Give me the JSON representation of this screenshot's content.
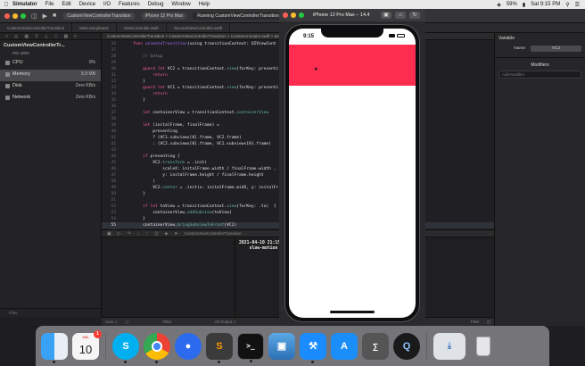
{
  "menubar": {
    "apple_icon": "apple-logo",
    "app_name": "Simulator",
    "items": [
      "File",
      "Edit",
      "Device",
      "I/O",
      "Features",
      "Debug",
      "Window",
      "Help"
    ],
    "battery": "59%",
    "clock": "Sat 9:15 PM"
  },
  "xcode": {
    "scheme": "CustomViewControllerTransition",
    "device": "iPhone 12 Pro Max",
    "status": "Running CustomViewControllerTransition on iPhone 12 Pro Max",
    "tabs": [
      "CustomViewControllerTransition",
      "Main.storyboard",
      "ViewController.swift",
      "SecondViewController.swift"
    ],
    "jumpbar": "CustomViewControllerTransition > CustomViewControllerTransition > CustomAnimator.swift > animateTransition(using:)"
  },
  "navigator": {
    "project": "CustomViewControllerTr...",
    "pid": "PID 4800",
    "gauges": [
      {
        "name": "CPU",
        "value": "0%"
      },
      {
        "name": "Memory",
        "value": "8.8 MB"
      },
      {
        "name": "Disk",
        "value": "Zero KB/s"
      },
      {
        "name": "Network",
        "value": "Zero KB/s"
      }
    ],
    "filter": "Filter"
  },
  "code": {
    "lines": [
      {
        "n": "26",
        "parts": [
          {
            "c": "kw",
            "t": "    func "
          },
          {
            "c": "fn",
            "t": "animateTransition"
          },
          {
            "c": "",
            "t": "(using transitionContext: UIViewCont"
          }
        ]
      },
      {
        "n": "27",
        "parts": []
      },
      {
        "n": "28",
        "parts": [
          {
            "c": "cm",
            "t": "        // Setup"
          }
        ]
      },
      {
        "n": "29",
        "parts": []
      },
      {
        "n": "30",
        "parts": [
          {
            "c": "kw",
            "t": "        guard let "
          },
          {
            "c": "",
            "t": "VC2 = transitionContext."
          },
          {
            "c": "pr",
            "t": "view"
          },
          {
            "c": "",
            "t": "(forKey: presenti"
          }
        ]
      },
      {
        "n": "31",
        "parts": [
          {
            "c": "kw",
            "t": "            return"
          }
        ]
      },
      {
        "n": "32",
        "parts": [
          {
            "c": "",
            "t": "        }"
          }
        ]
      },
      {
        "n": "33",
        "parts": [
          {
            "c": "kw",
            "t": "        guard let "
          },
          {
            "c": "",
            "t": "VC1 = transitionContext."
          },
          {
            "c": "pr",
            "t": "view"
          },
          {
            "c": "",
            "t": "(forKey: presenti"
          }
        ]
      },
      {
        "n": "34",
        "parts": [
          {
            "c": "kw",
            "t": "            return"
          }
        ]
      },
      {
        "n": "35",
        "parts": [
          {
            "c": "",
            "t": "        }"
          }
        ]
      },
      {
        "n": "36",
        "parts": []
      },
      {
        "n": "37",
        "parts": [
          {
            "c": "kw",
            "t": "        let "
          },
          {
            "c": "",
            "t": "containerView = transitionContext."
          },
          {
            "c": "pr",
            "t": "containerView"
          }
        ]
      },
      {
        "n": "38",
        "parts": []
      },
      {
        "n": "39",
        "parts": [
          {
            "c": "kw",
            "t": "        let "
          },
          {
            "c": "",
            "t": "(initalFrame, finalFrame) ="
          }
        ]
      },
      {
        "n": "40",
        "parts": [
          {
            "c": "",
            "t": "            presenting"
          }
        ]
      },
      {
        "n": "41",
        "parts": [
          {
            "c": "",
            "t": "            ? (VC1.subviews[0].frame, VC2.frame)"
          }
        ]
      },
      {
        "n": "42",
        "parts": [
          {
            "c": "",
            "t": "            : (VC2.subviews[0].frame, VC1.subviews[0].frame)"
          }
        ]
      },
      {
        "n": "43",
        "parts": []
      },
      {
        "n": "44",
        "parts": [
          {
            "c": "kw",
            "t": "        if "
          },
          {
            "c": "",
            "t": "presenting {"
          }
        ]
      },
      {
        "n": "45",
        "parts": [
          {
            "c": "",
            "t": "            VC2."
          },
          {
            "c": "pr",
            "t": "transform"
          },
          {
            "c": "",
            "t": " = .init("
          }
        ]
      },
      {
        "n": "46",
        "parts": [
          {
            "c": "",
            "t": "                scaleX: initalFrame.width / finalFrame.width ,"
          }
        ]
      },
      {
        "n": "47",
        "parts": [
          {
            "c": "",
            "t": "                y: initalFrame.height / finalFrame.height"
          }
        ]
      },
      {
        "n": "48",
        "parts": [
          {
            "c": "",
            "t": "            )"
          }
        ]
      },
      {
        "n": "49",
        "parts": [
          {
            "c": "",
            "t": "            VC2."
          },
          {
            "c": "pr",
            "t": "center"
          },
          {
            "c": "",
            "t": " = .init(x: initalFrame.midX, y: initalFr"
          }
        ]
      },
      {
        "n": "50",
        "parts": [
          {
            "c": "",
            "t": "        }"
          }
        ]
      },
      {
        "n": "51",
        "parts": []
      },
      {
        "n": "52",
        "parts": [
          {
            "c": "kw",
            "t": "        if let "
          },
          {
            "c": "",
            "t": "toView = transitionContext."
          },
          {
            "c": "pr",
            "t": "view"
          },
          {
            "c": "",
            "t": "(forKey: .to)  {"
          }
        ]
      },
      {
        "n": "53",
        "parts": [
          {
            "c": "",
            "t": "            containerView."
          },
          {
            "c": "pr",
            "t": "addSubview"
          },
          {
            "c": "",
            "t": "(toView)"
          }
        ]
      },
      {
        "n": "54",
        "parts": [
          {
            "c": "",
            "t": "        }"
          }
        ]
      },
      {
        "n": "55",
        "parts": [
          {
            "c": "",
            "t": "        containerView."
          },
          {
            "c": "pr",
            "t": "bringSubviewToFront"
          },
          {
            "c": "",
            "t": "(VC2)"
          }
        ]
      },
      {
        "n": "56",
        "parts": []
      }
    ],
    "highlight_index": 29
  },
  "debug": {
    "path": "CustomViewControllerTransition",
    "console_lines": [
      "2021-04-10 21:15:                            4800] Simulator",
      "    slow-motion a"
    ],
    "auto_label": "Auto ◇",
    "filter": "Filter",
    "output": "All Output ◇"
  },
  "inspector": {
    "title": "Variable",
    "name_label": "Name",
    "name_value": "VC2",
    "modifiers": "Modifiers",
    "add_placeholder": "Add Modifier"
  },
  "simulator": {
    "title": "iPhone 12 Pro Max – 14.4",
    "time": "9:15",
    "red_color": "#fc2d4f"
  },
  "dock": {
    "calendar_month": "JUL",
    "calendar_day": "10",
    "calendar_badge": "1",
    "terminal_prompt": ">_",
    "apps": [
      "finder",
      "calendar",
      "skype",
      "chrome",
      "signal",
      "sublime",
      "terminal",
      "preview",
      "xcode",
      "app-store",
      "calculator",
      "quicktime",
      "downloads",
      "trash"
    ]
  }
}
